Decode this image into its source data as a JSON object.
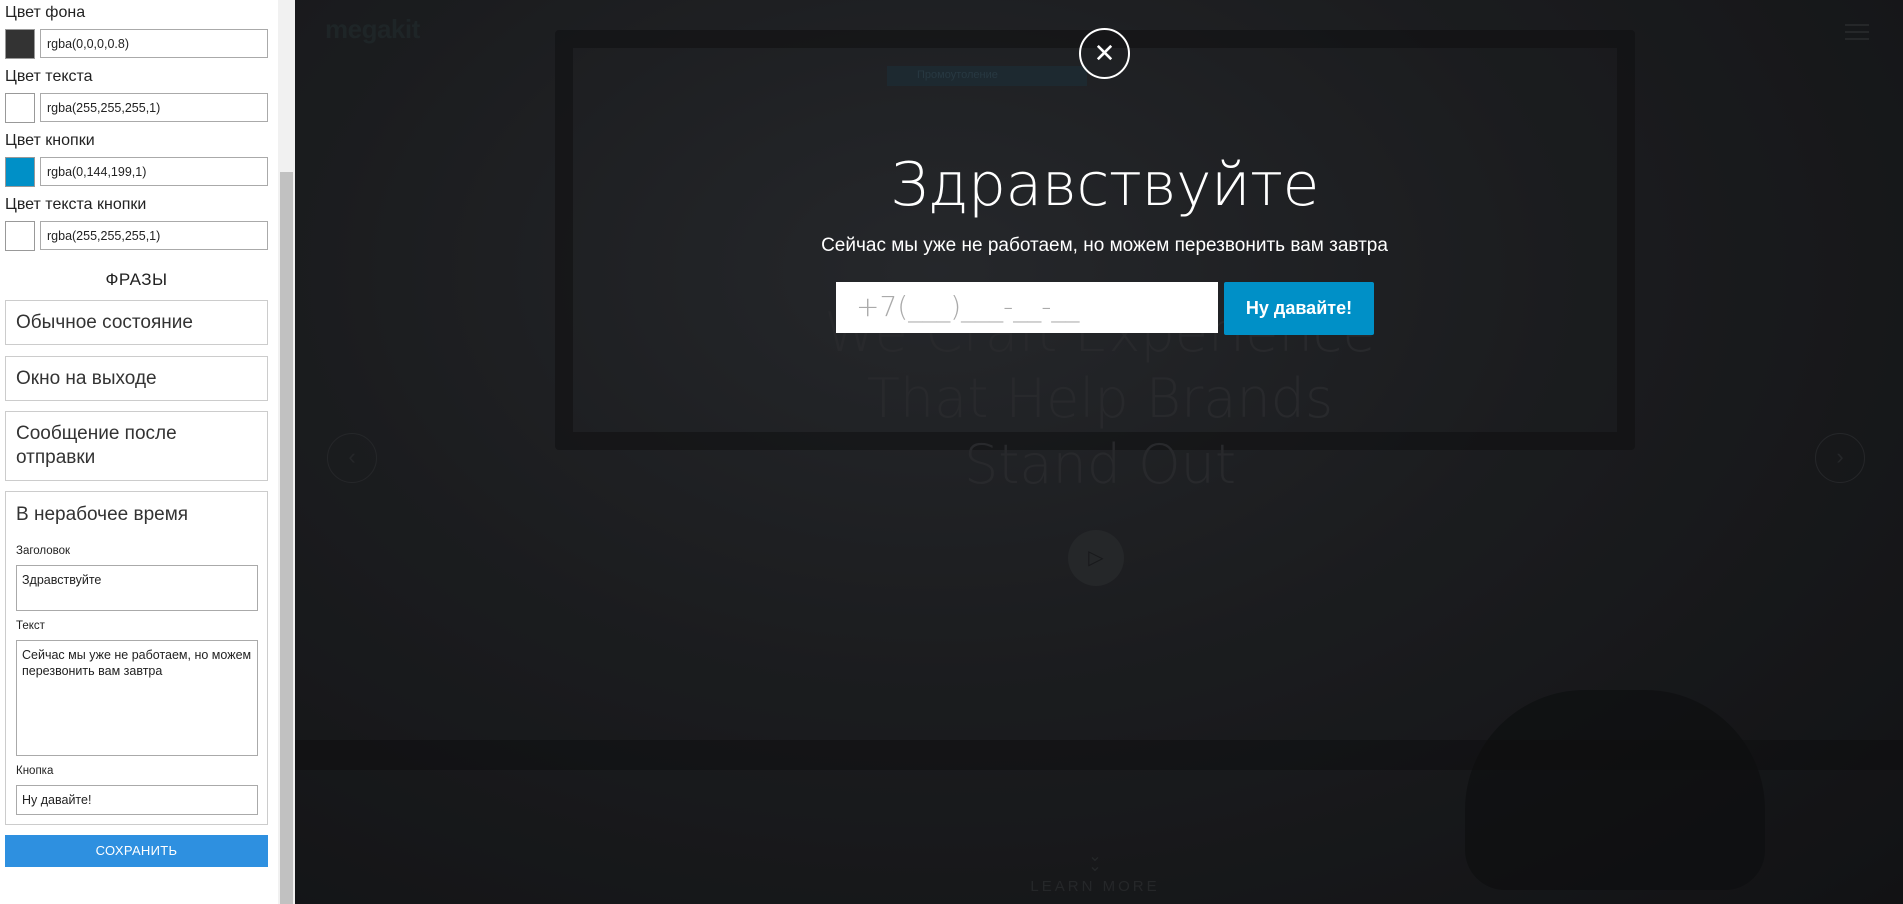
{
  "colors": {
    "bg": {
      "label": "Цвет фона",
      "value": "rgba(0,0,0,0.8)",
      "swatch": "#333333"
    },
    "text": {
      "label": "Цвет текста",
      "value": "rgba(255,255,255,1)",
      "swatch": "#ffffff"
    },
    "button": {
      "label": "Цвет кнопки",
      "value": "rgba(0,144,199,1)",
      "swatch": "#0090c7"
    },
    "button_text": {
      "label": "Цвет текста кнопки",
      "value": "rgba(255,255,255,1)",
      "swatch": "#ffffff"
    }
  },
  "phrases": {
    "title": "ФРАЗЫ",
    "normal": "Обычное состояние",
    "exit": "Окно на выходе",
    "after_send": "Сообщение после отправки",
    "offhours": {
      "title": "В нерабочее время",
      "heading_label": "Заголовок",
      "heading_value": "Здравствуйте",
      "text_label": "Текст",
      "text_value": "Сейчас мы уже не работаем, но можем перезвонить вам завтра",
      "button_label": "Кнопка",
      "button_value": "Ну давайте!"
    }
  },
  "save_label": "СОХРАНИТЬ",
  "site": {
    "logo": "megakit",
    "tab": "Промоутоление",
    "hero_line1": "We Craft Experience",
    "hero_line2": "That Help Brands",
    "hero_line3": "Stand Out",
    "learn_more": "LEARN MORE"
  },
  "modal": {
    "title": "Здравствуйте",
    "text": "Сейчас мы уже не работаем, но можем перезвонить вам завтра",
    "phone_placeholder": "+7(___)___-__-__",
    "button": "Ну давайте!"
  }
}
